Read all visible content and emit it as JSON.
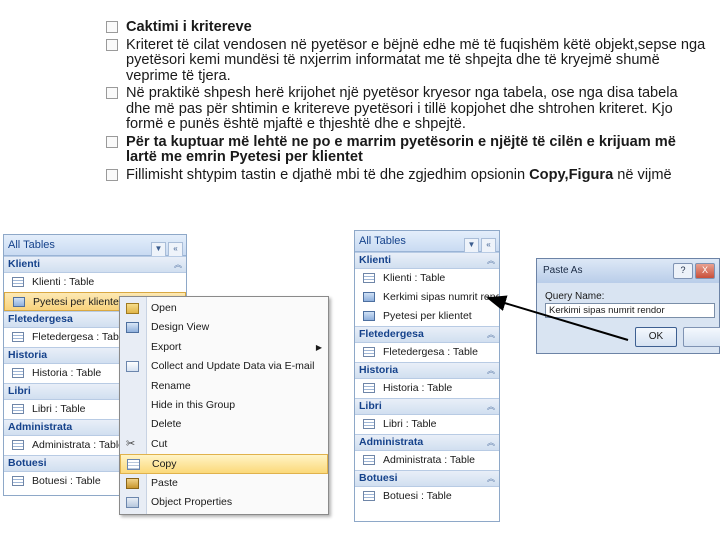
{
  "bullets": [
    {
      "text": "Caktimi i kritereve",
      "bold": true
    },
    {
      "text": "Kriteret të cilat vendosen në pyetësor e bëjnë edhe më të fuqishëm këtë objekt,sepse nga pyetësori kemi mundësi të nxjerrim informatat me të shpejta dhe të kryejmë shumë veprime të tjera.",
      "bold": false
    },
    {
      "text": "Në praktikë shpesh herë krijohet një pyetësor kryesor nga tabela, ose nga disa tabela dhe më pas për shtimin e kritereve pyetësori i tillë kopjohet dhe shtrohen kriteret. Kjo formë e punës është mjaftë e thjeshtë dhe e shpejtë.",
      "bold": false
    },
    {
      "text": "Për ta kuptuar më lehtë ne po e marrim pyetësorin e njëjtë të cilën e krijuam më lartë me emrin Pyetesi per klientet",
      "bold": true
    },
    {
      "text_pre": "Fillimisht shtypim tastin e djathë mbi të dhe zgjedhim opsionin ",
      "text_bold": "Copy,Figura",
      "text_post": " në vijmë"
    }
  ],
  "left_pane": {
    "title": "All Tables",
    "groups": [
      {
        "name": "Klienti",
        "items": [
          {
            "label": "Klienti : Table",
            "type": "table"
          },
          {
            "label": "Pyetesi per klientet",
            "type": "query",
            "selected": true
          }
        ]
      },
      {
        "name": "Fletedergesa",
        "items": [
          {
            "label": "Fletedergesa : Table",
            "type": "table"
          }
        ]
      },
      {
        "name": "Historia",
        "items": [
          {
            "label": "Historia : Table",
            "type": "table"
          }
        ]
      },
      {
        "name": "Libri",
        "items": [
          {
            "label": "Libri : Table",
            "type": "table"
          }
        ]
      },
      {
        "name": "Administrata",
        "items": [
          {
            "label": "Administrata : Table",
            "type": "table"
          }
        ]
      },
      {
        "name": "Botuesi",
        "items": [
          {
            "label": "Botuesi : Table",
            "type": "table"
          }
        ]
      }
    ]
  },
  "context_menu": {
    "items": [
      {
        "label": "Open",
        "icon": "open-icon"
      },
      {
        "label": "Design View",
        "icon": "design-view-icon"
      },
      {
        "label": "Export",
        "icon": "",
        "submenu": true
      },
      {
        "label": "Collect and Update Data via E-mail",
        "icon": "email-icon"
      },
      {
        "label": "Rename",
        "icon": ""
      },
      {
        "label": "Hide in this Group",
        "icon": ""
      },
      {
        "label": "Delete",
        "icon": ""
      },
      {
        "label": "Cut",
        "icon": "scissors-icon"
      },
      {
        "label": "Copy",
        "icon": "copy-icon",
        "highlighted": true
      },
      {
        "label": "Paste",
        "icon": "paste-icon"
      },
      {
        "label": "Object Properties",
        "icon": "properties-icon"
      }
    ]
  },
  "right_pane": {
    "title": "All Tables",
    "groups": [
      {
        "name": "Klienti",
        "items": [
          {
            "label": "Klienti : Table",
            "type": "table"
          },
          {
            "label": "Kerkimi sipas numrit rendor",
            "type": "query"
          },
          {
            "label": "Pyetesi per klientet",
            "type": "query"
          }
        ]
      },
      {
        "name": "Fletedergesa",
        "items": [
          {
            "label": "Fletedergesa : Table",
            "type": "table"
          }
        ]
      },
      {
        "name": "Historia",
        "items": [
          {
            "label": "Historia : Table",
            "type": "table"
          }
        ]
      },
      {
        "name": "Libri",
        "items": [
          {
            "label": "Libri : Table",
            "type": "table"
          }
        ]
      },
      {
        "name": "Administrata",
        "items": [
          {
            "label": "Administrata : Table",
            "type": "table"
          }
        ]
      },
      {
        "name": "Botuesi",
        "items": [
          {
            "label": "Botuesi : Table",
            "type": "table"
          }
        ]
      }
    ]
  },
  "paste_dialog": {
    "title": "Paste As",
    "help": "?",
    "close": "X",
    "label": "Query Name:",
    "value": "Kerkimi sipas numrit rendor",
    "ok": "OK"
  },
  "colors": {
    "accent": "#15428b",
    "highlight": "#f8d27c",
    "arrow": "#000000"
  }
}
